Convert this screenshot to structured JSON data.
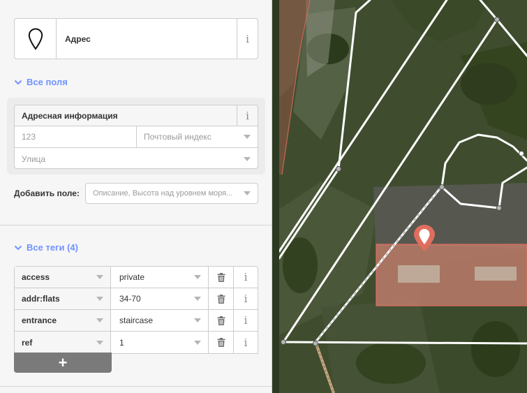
{
  "preset": {
    "name": "Адрес",
    "icon": "map-pin-icon",
    "info": "i"
  },
  "all_fields": {
    "header": "Все поля",
    "address": {
      "label": "Адресная информация",
      "info": "i",
      "housenumber_value": "123",
      "postcode_placeholder": "Почтовый индекс",
      "street_placeholder": "Улица"
    },
    "add_field_label": "Добавить поле:",
    "add_field_placeholder": "Описание, Высота над уровнем моря..."
  },
  "all_tags": {
    "header": "Все теги (4)",
    "rows": [
      {
        "key": "access",
        "value": "private"
      },
      {
        "key": "addr:flats",
        "value": "34-70"
      },
      {
        "key": "entrance",
        "value": "staircase"
      },
      {
        "key": "ref",
        "value": "1"
      }
    ],
    "add_label": "+"
  },
  "colors": {
    "accent": "#7092ff",
    "pin": "#e06e5f",
    "building": "#e06e5f"
  }
}
